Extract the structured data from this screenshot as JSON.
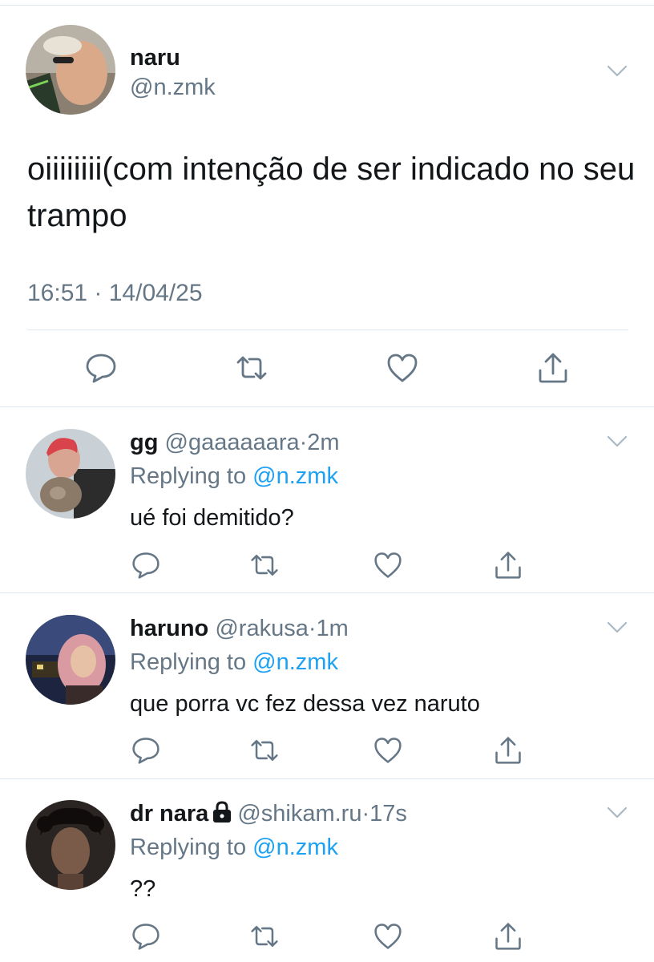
{
  "main_tweet": {
    "name": "naru",
    "handle": "@n.zmk",
    "text": "oiiiiiiii(com intenção de ser indicado no seu trampo",
    "timestamp": "16:51 · 14/04/25"
  },
  "replies": [
    {
      "name": "gg",
      "handle": "@gaaaaaara",
      "separator": "·",
      "time": "2m",
      "replying_prefix": "Replying to ",
      "replying_to": "@n.zmk",
      "text": "ué foi demitido?",
      "locked": false
    },
    {
      "name": "haruno",
      "handle": "@rakusa",
      "separator": "·",
      "time": "1m",
      "replying_prefix": "Replying to ",
      "replying_to": "@n.zmk",
      "text": "que porra vc fez dessa vez naruto",
      "locked": false
    },
    {
      "name": "dr nara",
      "handle": "@shikam.ru",
      "separator": "·",
      "time": "17s",
      "replying_prefix": "Replying to ",
      "replying_to": "@n.zmk",
      "text": "??",
      "locked": true
    }
  ],
  "icons": {
    "reply": "reply-icon",
    "retweet": "retweet-icon",
    "like": "heart-icon",
    "share": "share-icon",
    "more": "chevron-down-icon",
    "lock": "lock-icon"
  },
  "colors": {
    "text": "#14171a",
    "secondary": "#657786",
    "link": "#1da1f2",
    "divider": "#e1e8ed"
  }
}
